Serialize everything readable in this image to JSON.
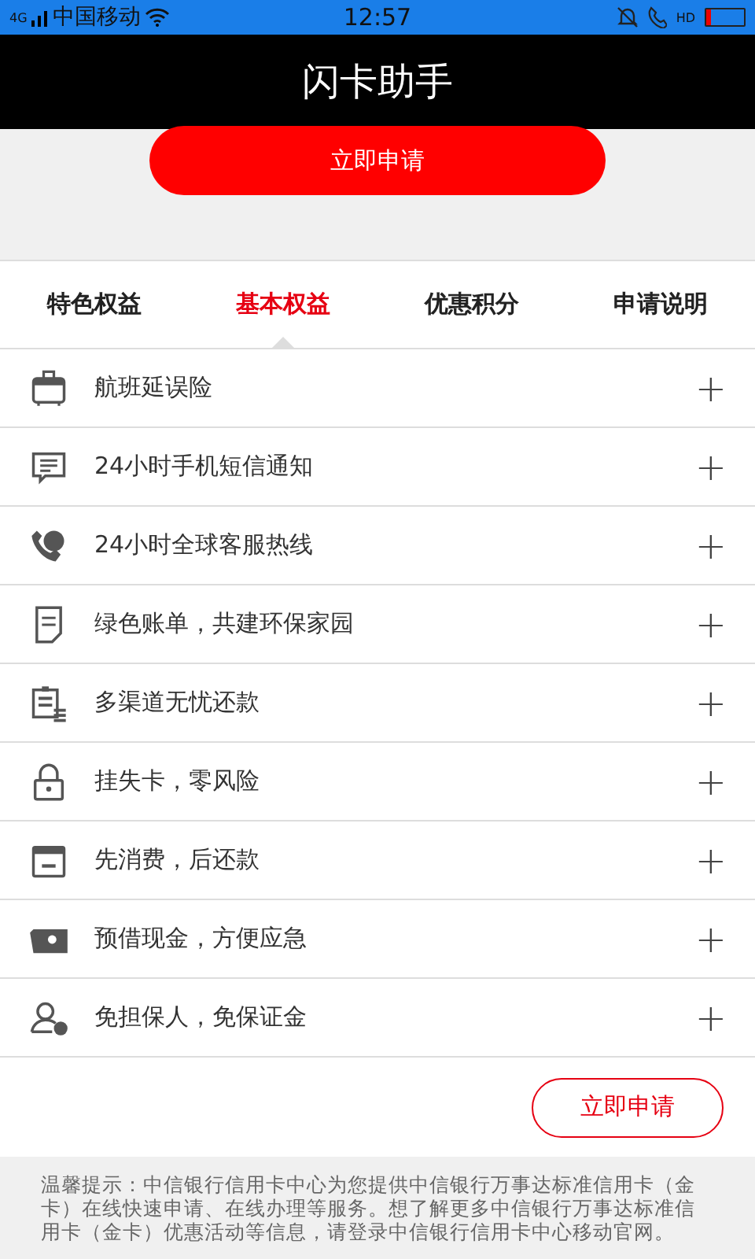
{
  "status_bar": {
    "network": "4G",
    "carrier": "中国移动",
    "time": "12:57",
    "call_badge": "HD"
  },
  "header": {
    "title": "闪卡助手"
  },
  "top_button": "立即申请",
  "tabs": [
    {
      "label": "特色权益",
      "selected": false
    },
    {
      "label": "基本权益",
      "selected": true
    },
    {
      "label": "优惠积分",
      "selected": false
    },
    {
      "label": "申请说明",
      "selected": false
    }
  ],
  "items": [
    {
      "label": "航班延误险",
      "toggle": "+"
    },
    {
      "label": "24小时手机短信通知",
      "toggle": "+"
    },
    {
      "label": "24小时全球客服热线",
      "toggle": "+"
    },
    {
      "label": "绿色账单，共建环保家园",
      "toggle": "+"
    },
    {
      "label": "多渠道无忧还款",
      "toggle": "+"
    },
    {
      "label": "挂失卡，零风险",
      "toggle": "+"
    },
    {
      "label": "先消费，后还款",
      "toggle": "+"
    },
    {
      "label": "预借现金，方便应急",
      "toggle": "+"
    },
    {
      "label": "免担保人，免保证金",
      "toggle": "+"
    }
  ],
  "bottom_button": "立即申请",
  "notice": "温馨提示：中信银行信用卡中心为您提供中信银行万事达标准信用卡（金卡）在线快速申请、在线办理等服务。想了解更多中信银行万事达标准信用卡（金卡）优惠活动等信息，请登录中信银行信用卡中心移动官网。"
}
